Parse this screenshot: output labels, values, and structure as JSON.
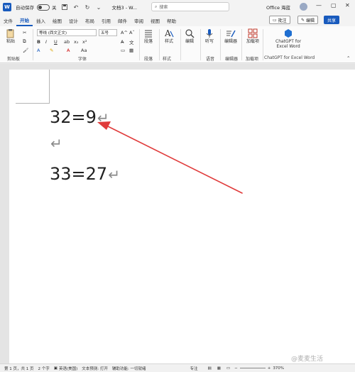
{
  "titlebar": {
    "logo": "W",
    "autosave_label": "自动保存",
    "autosave_state": "关",
    "doc_title": "文档3 - W...",
    "search_placeholder": "搜索",
    "account": "Office 海蓝",
    "minimize": "—",
    "maximize": "▢",
    "close": "✕"
  },
  "tabs": [
    "文件",
    "开始",
    "插入",
    "绘图",
    "设计",
    "布局",
    "引用",
    "邮件",
    "审阅",
    "视图",
    "帮助"
  ],
  "active_tab": "开始",
  "actions": {
    "comment": "批注",
    "edit": "编辑",
    "share": "共享"
  },
  "ribbon": {
    "paste": "粘贴",
    "clipboard_label": "剪贴板",
    "font_name": "等线 (西文正文)",
    "font_size": "五号",
    "font_label": "字体",
    "bold": "B",
    "italic": "I",
    "underline": "U",
    "paragraph_btn": "段落",
    "paragraph_label": "段落",
    "styles_btn": "样式",
    "styles_label": "样式",
    "editing_btn": "编辑",
    "dictate_btn": "听写",
    "voice_label": "语音",
    "editor_btn": "编辑器",
    "editor_label": "编辑器",
    "addins_btn": "加载项",
    "addins_label": "加载项",
    "chatgpt_btn_line1": "ChatGPT for",
    "chatgpt_btn_line2": "Excel Word",
    "chatgpt_label": "ChatGPT for Excel Word"
  },
  "document": {
    "line1": "32=9",
    "line3": "33=27",
    "para_mark": "↵"
  },
  "statusbar": {
    "page": "第 1 页，共 1 页",
    "words": "2 个字",
    "language": "英语(美国)",
    "predict": "文本预测: 打开",
    "accessibility": "辅助功能: 一切就绪",
    "focus": "专注",
    "zoom": "370%"
  },
  "watermark": "@麦麦生活",
  "colors": {
    "accent": "#185abd",
    "arrow": "#e03b3b"
  }
}
